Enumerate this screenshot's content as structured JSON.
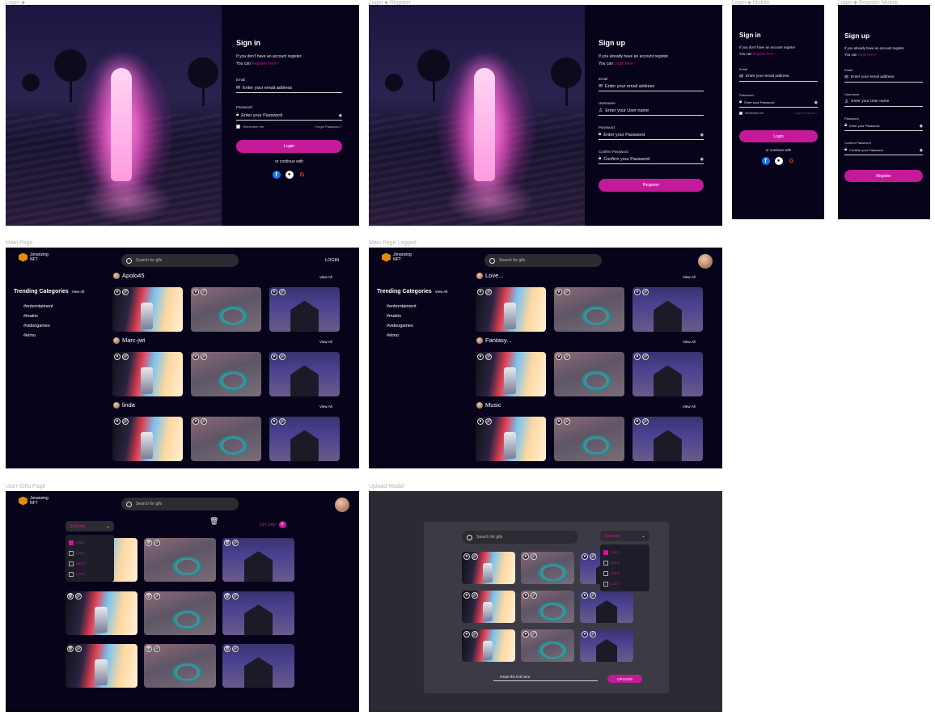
{
  "labels": {
    "f1": "Login ⬥",
    "f2": "Login ⬥ Register",
    "f3": "Login ⬥ Mobile",
    "f4": "Login ⬥ Register Mobile",
    "f5": "Main Page",
    "f6": "Main Page Logged",
    "f7": "User Gifts Page",
    "f8": "Upload Modal"
  },
  "signin": {
    "title": "Sign in",
    "line1": "If you don't have an account register",
    "line2_prefix": "You can",
    "line2_link": "Register here !",
    "email_label": "Email",
    "email_placeholder": "Enter your email address",
    "password_label": "Password",
    "password_placeholder": "Enter your Password",
    "remember": "Remember me",
    "forgot": "Forgot Password ?",
    "login_btn": "Login",
    "continue": "or continue with"
  },
  "signup": {
    "title": "Sign up",
    "line1": "If you already have an account register",
    "line2_prefix": "You can",
    "line2_link": "Login here !",
    "email_label": "Email",
    "email_placeholder": "Enter your email address",
    "username_label": "Username",
    "username_placeholder": "Enter your User name",
    "password_label": "Password",
    "password_placeholder": "Enter your Password",
    "confirm_label": "Confirm Password",
    "confirm_placeholder": "Confirm your Password",
    "register_btn": "Register"
  },
  "app": {
    "logo_line1": "Jonanzing",
    "logo_line2": "NFT",
    "search_placeholder": "Search for gifs",
    "login": "LOGIN",
    "trending": "Trending Categories",
    "view_all": "View All",
    "categories": [
      "#enterntaiment",
      "#matrix",
      "#videogames",
      "#elmo"
    ],
    "main_rows": [
      "Apolo45",
      "Marc-jwt",
      "linda"
    ],
    "logged_rows": [
      "Love...",
      "Fantasy...",
      "Music"
    ]
  },
  "gifts": {
    "select_label": "Selected",
    "upload": "UPLOAD",
    "options": [
      "List 1",
      "List 2",
      "List 3",
      "List 4"
    ]
  },
  "modal": {
    "select_label": "Selected",
    "paste_placeholder": "Paste the link here",
    "upload_btn": "UPLOAD",
    "options": [
      "List 1",
      "List 2",
      "List 3",
      "List 4"
    ]
  },
  "colors": {
    "accent": "#c41a9a",
    "bg": "#06031a",
    "logo": "#e08a10"
  }
}
